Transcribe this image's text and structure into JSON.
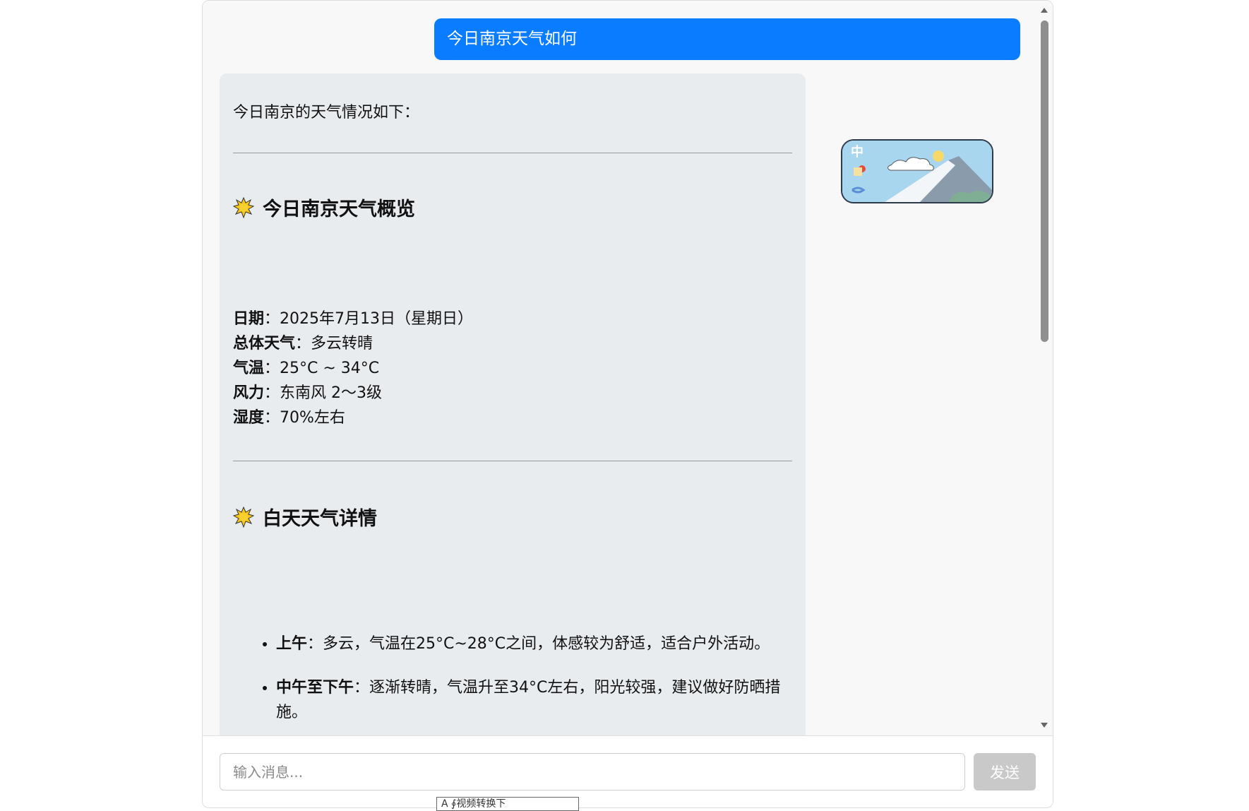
{
  "chat": {
    "user_message": "今日南京天气如何",
    "bot": {
      "intro": "今日南京的天气情况如下：",
      "section1_title": "今日南京天气概览",
      "facts": [
        {
          "label": "日期",
          "value": "：2025年7月13日（星期日）"
        },
        {
          "label": "总体天气",
          "value": "：多云转晴"
        },
        {
          "label": "气温",
          "value": "：25°C ~ 34°C"
        },
        {
          "label": "风力",
          "value": "：东南风 2～3级"
        },
        {
          "label": "湿度",
          "value": "：70%左右"
        }
      ],
      "section2_title": "白天天气详情",
      "details": [
        {
          "label": "上午",
          "value": "：多云，气温在25°C~28°C之间，体感较为舒适，适合户外活动。"
        },
        {
          "label": "中午至下午",
          "value": "：逐渐转晴，气温升至34°C左右，阳光较强，建议做好防晒措施。"
        }
      ]
    }
  },
  "thumbnail": {
    "sign_text": "中"
  },
  "input": {
    "placeholder": "输入消息...",
    "send_label": "发送"
  },
  "tooltip": {
    "text": "A          ∮视频转换下"
  },
  "colors": {
    "user_bubble": "#0a7cff",
    "bot_bubble": "#e9ecef",
    "send_disabled": "#c9c9c9",
    "sun": "#f5c518"
  }
}
